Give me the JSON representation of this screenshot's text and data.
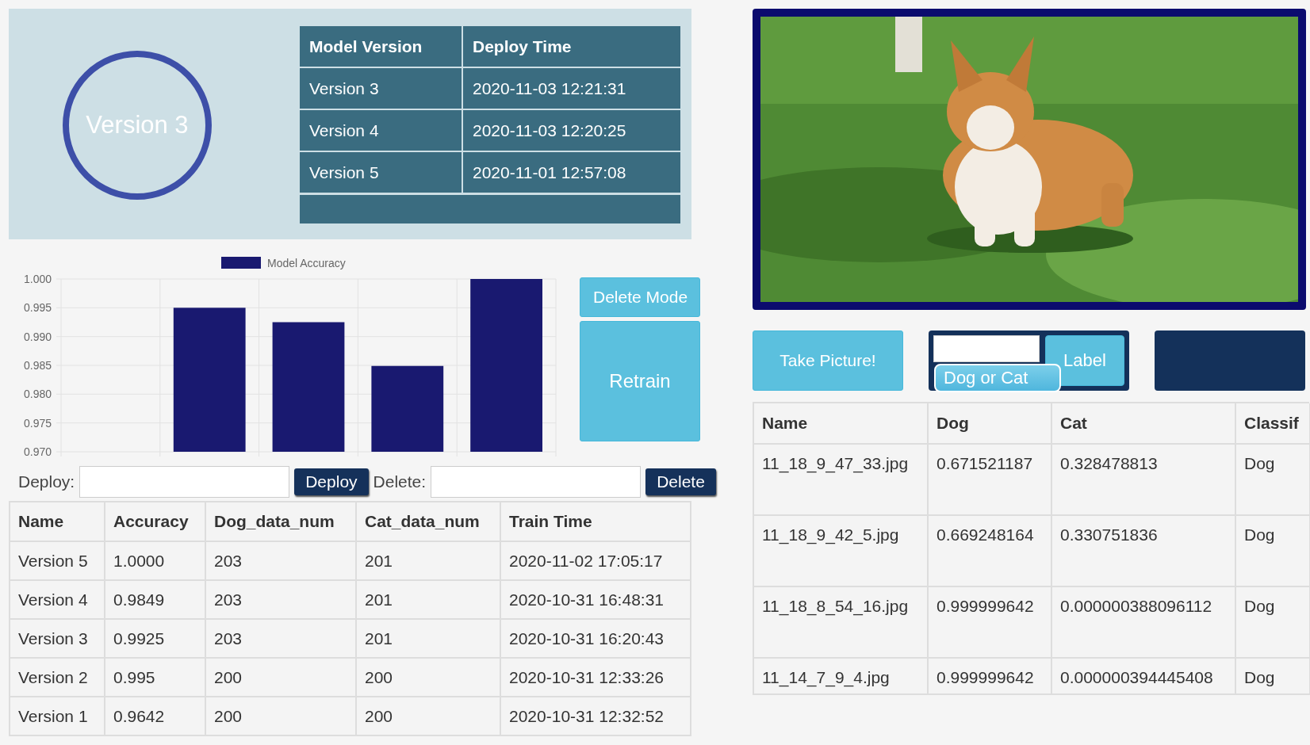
{
  "current_model": {
    "label": "Version 3"
  },
  "deploy_table": {
    "columns": [
      "Model Version",
      "Deploy Time"
    ],
    "rows": [
      [
        "Version 3",
        "2020-11-03 12:21:31"
      ],
      [
        "Version 4",
        "2020-11-03 12:20:25"
      ],
      [
        "Version 5",
        "2020-11-01 12:57:08"
      ]
    ]
  },
  "accuracy_chart": {
    "chart_data": {
      "type": "bar",
      "grid": true,
      "ylim": [
        0.97,
        1.0
      ],
      "yticks": [
        {
          "value": 1.0,
          "label": "1.000"
        },
        {
          "value": 0.995,
          "label": "0.995"
        },
        {
          "value": 0.99,
          "label": "0.990"
        },
        {
          "value": 0.985,
          "label": "0.985"
        },
        {
          "value": 0.98,
          "label": "0.980"
        },
        {
          "value": 0.975,
          "label": "0.975"
        },
        {
          "value": 0.97,
          "label": "0.970"
        }
      ],
      "series": [
        {
          "name": "Model Accuracy",
          "color": "#191970",
          "values": [
            null,
            0.995,
            0.9925,
            0.9849,
            1.0
          ]
        }
      ]
    }
  },
  "side_buttons": [
    "Delete Mode",
    "Retrain"
  ],
  "deploy_bar": {
    "deploy_label": "Deploy:",
    "deploy_button": "Deploy",
    "delete_label": "Delete:",
    "delete_button": "Delete"
  },
  "models_table": {
    "columns": [
      "Name",
      "Accuracy",
      "Dog_data_num",
      "Cat_data_num",
      "Train Time"
    ],
    "rows": [
      [
        "Version 5",
        "1.0000",
        "203",
        "201",
        "2020-11-02 17:05:17"
      ],
      [
        "Version 4",
        "0.9849",
        "203",
        "201",
        "2020-10-31 16:48:31"
      ],
      [
        "Version 3",
        "0.9925",
        "203",
        "201",
        "2020-10-31 16:20:43"
      ],
      [
        "Version 2",
        "0.995",
        "200",
        "200",
        "2020-10-31 12:33:26"
      ],
      [
        "Version 1",
        "0.9642",
        "200",
        "200",
        "2020-10-31 12:32:52"
      ]
    ]
  },
  "camera": {
    "kind": "picture"
  },
  "capture": {
    "take_button": "Take Picture!",
    "label_button": "Label",
    "suggestion": "Dog or Cat"
  },
  "predictions_table": {
    "columns": [
      "Name",
      "Dog",
      "Cat",
      "Classif"
    ],
    "rows": [
      [
        "11_18_9_47_33.jpg",
        "0.671521187",
        "0.328478813",
        "Dog"
      ],
      [
        "11_18_9_42_5.jpg",
        "0.669248164",
        "0.330751836",
        "Dog"
      ],
      [
        "11_18_8_54_16.jpg",
        "0.999999642",
        "0.000000388096112",
        "Dog"
      ],
      [
        "11_14_7_9_4.jpg",
        "0.999999642",
        "0.000000394445408",
        "Dog"
      ]
    ]
  }
}
